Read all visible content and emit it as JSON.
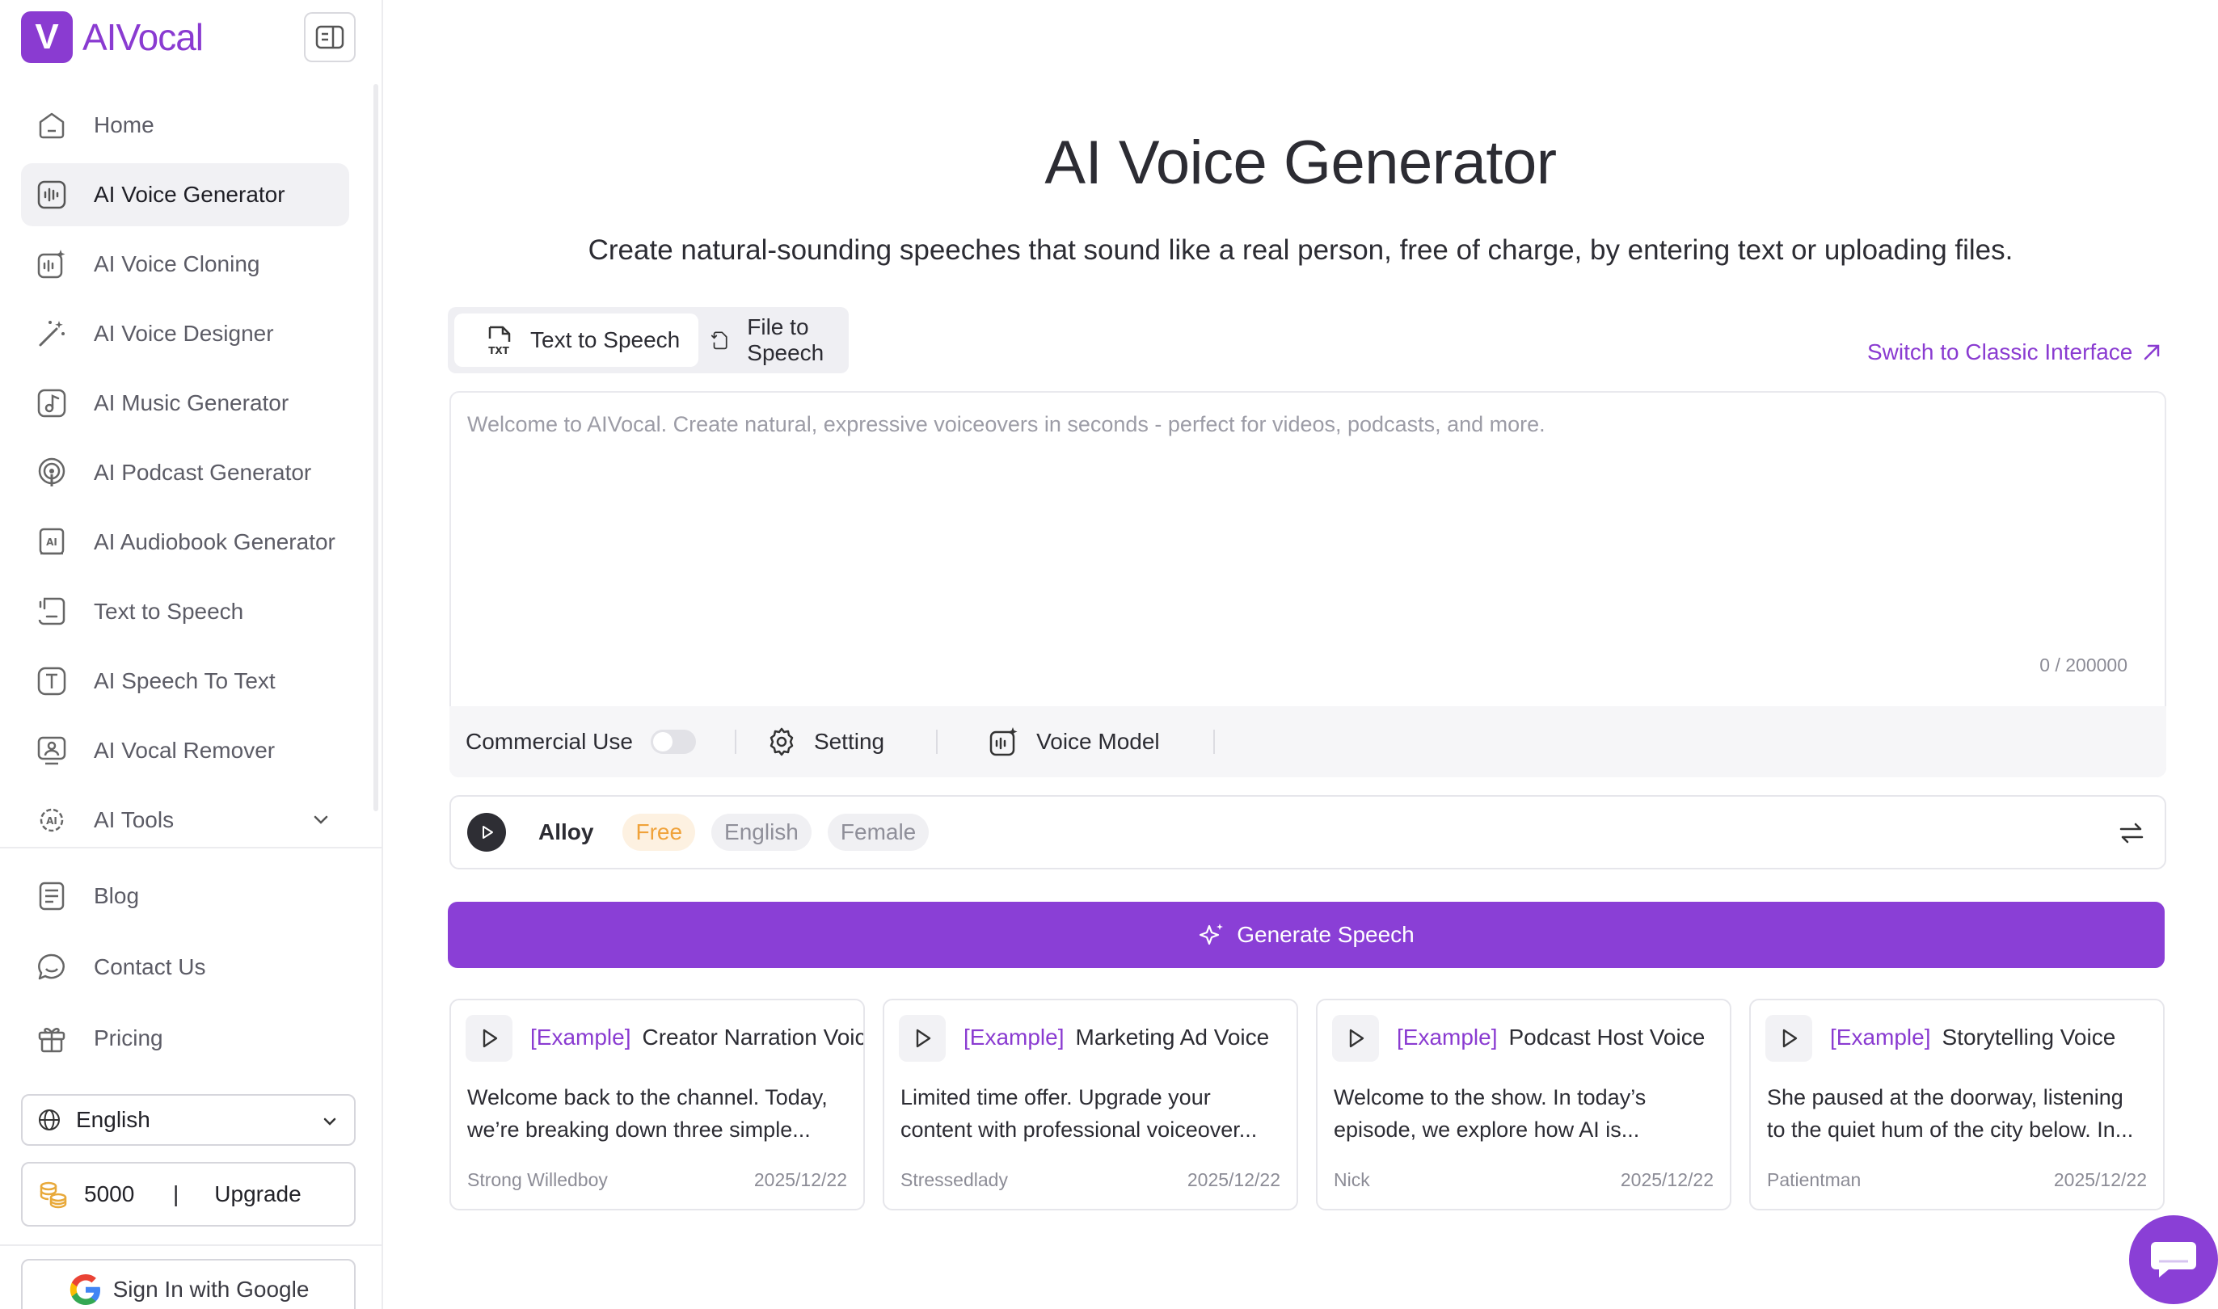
{
  "brand": {
    "logo_letter": "V",
    "name": "AIVocal",
    "color": "#8a3bd1"
  },
  "sidebar": {
    "items": [
      {
        "label": "Home",
        "icon": "home-icon"
      },
      {
        "label": "AI Voice Generator",
        "icon": "waveform-icon",
        "active": true
      },
      {
        "label": "AI Voice Cloning",
        "icon": "voice-clone-icon"
      },
      {
        "label": "AI Voice Designer",
        "icon": "magic-wand-icon"
      },
      {
        "label": "AI Music Generator",
        "icon": "music-note-icon"
      },
      {
        "label": "AI Podcast Generator",
        "icon": "podcast-icon"
      },
      {
        "label": "AI Audiobook Generator",
        "icon": "audiobook-icon"
      },
      {
        "label": "Text to Speech",
        "icon": "text-speech-icon"
      },
      {
        "label": "AI Speech To Text",
        "icon": "speech-text-icon"
      },
      {
        "label": "AI Vocal Remover",
        "icon": "vocal-remover-icon"
      },
      {
        "label": "AI Tools",
        "icon": "ai-tools-icon",
        "expandable": true
      }
    ],
    "secondary": [
      {
        "label": "Blog",
        "icon": "blog-icon"
      },
      {
        "label": "Contact Us",
        "icon": "chat-icon"
      },
      {
        "label": "Pricing",
        "icon": "gift-icon"
      }
    ],
    "language": "English",
    "credits": {
      "amount": "5000",
      "separator": "|",
      "upgrade_label": "Upgrade"
    },
    "google_signin_label": "Sign In with Google"
  },
  "main": {
    "title": "AI Voice Generator",
    "subtitle": "Create natural-sounding speeches that sound like a real person, free of charge, by entering text or uploading files.",
    "tabs": [
      {
        "label": "Text to Speech",
        "active": true
      },
      {
        "label": "File to Speech",
        "active": false
      }
    ],
    "classic_link": "Switch to Classic Interface",
    "editor": {
      "placeholder": "Welcome to AIVocal. Create natural, expressive voiceovers in seconds - perfect for videos, podcasts, and more.",
      "counter": "0 / 200000"
    },
    "toolbar": {
      "commercial_label": "Commercial Use",
      "commercial_on": false,
      "setting_label": "Setting",
      "voice_model_label": "Voice Model"
    },
    "voice": {
      "name": "Alloy",
      "tags": [
        "Free",
        "English",
        "Female"
      ]
    },
    "generate_label": "Generate Speech",
    "examples": [
      {
        "tag": "[Example]",
        "title": "Creator Narration Voice",
        "line1": "Welcome back to the channel. Today,",
        "line2": "we’re breaking down three simple...",
        "author": "Strong Willedboy",
        "date": "2025/12/22"
      },
      {
        "tag": "[Example]",
        "title": "Marketing Ad Voice",
        "line1": "Limited time offer. Upgrade your",
        "line2": "content with professional voiceover...",
        "author": "Stressedlady",
        "date": "2025/12/22"
      },
      {
        "tag": "[Example]",
        "title": "Podcast Host Voice",
        "line1": "Welcome to the show. In today’s",
        "line2": "episode, we explore how AI is...",
        "author": "Nick",
        "date": "2025/12/22"
      },
      {
        "tag": "[Example]",
        "title": "Storytelling Voice",
        "line1": "She paused at the doorway, listening",
        "line2": "to the quiet hum of the city below. In...",
        "author": "Patientman",
        "date": "2025/12/22"
      }
    ]
  },
  "colors": {
    "accent": "#8a3fd6",
    "free_tag": "#f0a23a",
    "muted": "#8f8f99"
  }
}
